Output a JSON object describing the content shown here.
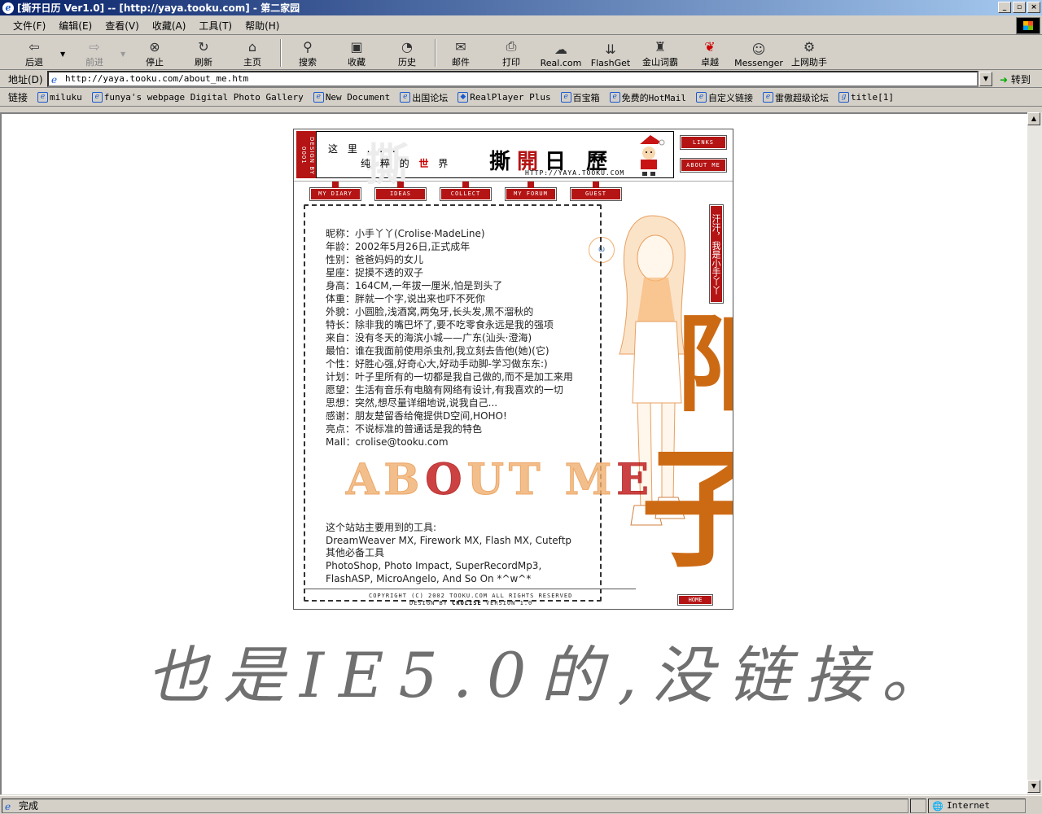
{
  "window": {
    "title": "[撕开日历  Ver1.0] -- [http://yaya.tooku.com] - 第二家园",
    "buttons": [
      "_",
      "▫",
      "×"
    ]
  },
  "menu": [
    "文件(F)",
    "编辑(E)",
    "查看(V)",
    "收藏(A)",
    "工具(T)",
    "帮助(H)"
  ],
  "toolbar": {
    "back": "后退",
    "forward": "前进",
    "stop": "停止",
    "refresh": "刷新",
    "home": "主页",
    "search": "搜索",
    "favorites": "收藏",
    "history": "历史",
    "mail": "邮件",
    "print": "打印",
    "real": "Real.com",
    "flashget": "FlashGet",
    "jinshan": "金山词霸",
    "zhuoyue": "卓越",
    "messenger": "Messenger",
    "helper": "上网助手"
  },
  "address": {
    "label": "地址(D)",
    "url": "http://yaya.tooku.com/about_me.htm",
    "go": "转到"
  },
  "links": {
    "title": "链接",
    "items": [
      "miluku",
      "funya's webpage Digital Photo Gallery",
      "New Document",
      "出国论坛",
      "RealPlayer Plus",
      "百宝箱",
      "免费的HotMail",
      "自定义链接",
      "雷傲超级论坛",
      "title[1]"
    ]
  },
  "status": {
    "text": "完成",
    "zone": "Internet"
  },
  "site": {
    "design_tag": "DESIGN BY",
    "design_num": "0001",
    "slogan1": "这 里 . . .",
    "slogan2_a": "纯 粹 的 ",
    "slogan2_red": "世",
    "slogan2_b": " 界",
    "title_a": "撕",
    "title_red": "開",
    "title_b": "日 歷",
    "url": "HTTP://YAYA.TOOKU.COM",
    "btn_links": "LINKS",
    "btn_about": "ABOUT ME",
    "nav": [
      "MY DIARY",
      "IDEAS",
      "COLLECT",
      "MY FORUM",
      "GUEST"
    ],
    "side_label": "汗汗，我是小手丫丫",
    "big1": "阳",
    "big2": "子",
    "bubble": "ω",
    "about_a": "AB",
    "about_red1": "O",
    "about_b": "UT M",
    "about_red2": "E",
    "profile": [
      "昵称：小手丫丫(Crolise·MadeLine)",
      "年龄：2002年5月26日,正式成年",
      "性别：爸爸妈妈的女儿",
      "星座：捉摸不透的双子",
      "身高：164CM,一年拔一厘米,怕是到头了",
      "体重：胖就一个字,说出来也吓不死你",
      "外貌：小圆脸,浅酒窝,两兔牙,长头发,黑不溜秋的",
      "特长：除非我的嘴巴坏了,要不吃零食永远是我的强项",
      "来自：没有冬天的海滨小城——广东(汕头·澄海)",
      "最怕：谁在我面前使用杀虫剂,我立刻去告他(她)(它)",
      "个性：好胜心强,好奇心大,好动手动脚-学习做东东:)",
      "计划：叶子里所有的一切都是我自己做的,而不是加工来用",
      "愿望：生活有音乐有电脑有网络有设计,有我喜欢的一切",
      "思想：突然,想尽量详细地说,说我自己...",
      "感谢：朋友楚留香给俺提供D空间,HOHO!",
      "亮点：不说标准的普通话是我的特色",
      "MaIl：crolise@tooku.com"
    ],
    "tools_title": "这个站站主要用到的工具:",
    "tools_1": "DreamWeaver MX, Firework MX, Flash MX, Cuteftp",
    "tools_other": "其他必备工具",
    "tools_2": "PhotoShop, Photo Impact, SuperRecordMp3,",
    "tools_3": "FlashASP, MicroAngelo, And So On *^w^*",
    "copyright": "COPYRIGHT (C) 2002 TOOKU.COM ALL RIGHTS RESERVED",
    "design_by_a": "DESIGN BY ",
    "design_by_b": "CROLISE",
    "design_by_c": " VERSION 1.0",
    "home": "HOME"
  },
  "handwriting": "也是IE5.0的,没链接。",
  "colors": {
    "accent_red": "#b41414",
    "orange": "#cc6a14"
  }
}
